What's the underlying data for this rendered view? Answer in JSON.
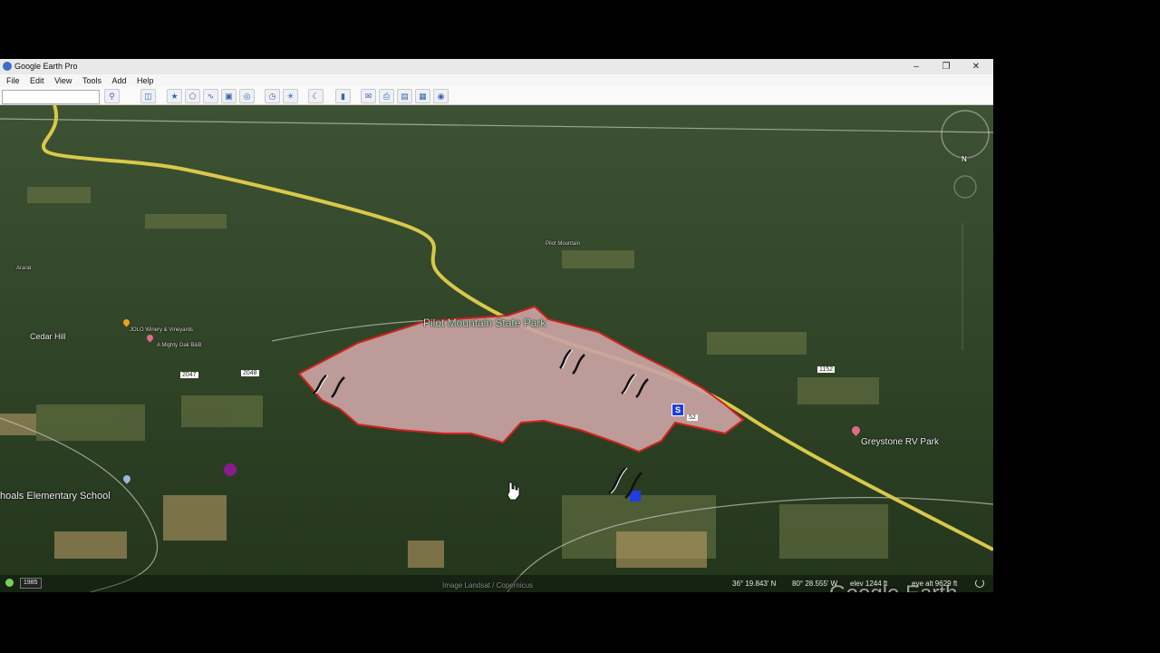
{
  "window": {
    "title": "Google Earth Pro",
    "minimize": "–",
    "maximize": "❐",
    "close": "✕"
  },
  "menu": [
    "File",
    "Edit",
    "View",
    "Tools",
    "Add",
    "Help"
  ],
  "search": {
    "value": "",
    "placeholder": ""
  },
  "toolbar_icons": [
    "search-icon",
    "sidebar-icon",
    "placemark-icon",
    "polygon-icon",
    "path-icon",
    "overlay-icon",
    "tour-icon",
    "historical-imagery-icon",
    "sunlight-icon",
    "sky-icon",
    "ruler-icon",
    "email-icon",
    "print-icon",
    "save-image-icon",
    "map-icon",
    "gallery-icon"
  ],
  "map": {
    "labels": {
      "park": "Pilot Mountain State Park",
      "cedar_hill": "Cedar Hill",
      "school": "hoals Elementary School",
      "greystone": "Greystone RV Park",
      "jolo": "JOLO Winery & Vineyards",
      "mighty_oak": "A Mighty Oak B&B",
      "pilot_mountain": "Pilot Mountain",
      "ararat": "Ararat",
      "copernicus": "Image Landsat / Copernicus",
      "google_earth": "Google Earth",
      "route_52": "52",
      "route_1152": "1152",
      "route_2047": "2047",
      "route_2048": "2048",
      "marker_s": "S",
      "compass_n": "N"
    },
    "colors": {
      "polygon_fill": "#c9a3a3",
      "polygon_stroke": "#d0211d",
      "highway": "#d9c84a",
      "marker_blue": "#1d3ee0",
      "marker_purple": "#8a1b8c"
    }
  },
  "status": {
    "year": "1985",
    "lat": "36° 19.843' N",
    "lon": "80° 28.555' W",
    "elev": "elev  1244 ft",
    "eye_alt": "eye alt   9629 ft"
  }
}
